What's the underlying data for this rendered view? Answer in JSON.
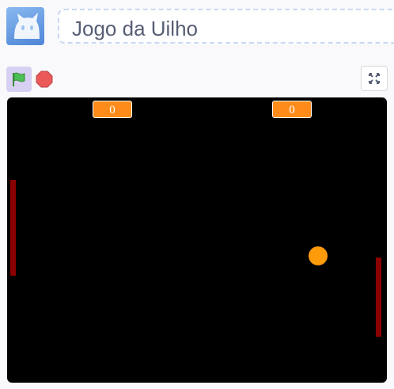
{
  "project": {
    "title": "Jogo da Uilho"
  },
  "controls": {
    "green_flag_icon": "green-flag-icon",
    "stop_icon": "stop-sign-icon",
    "fullscreen_icon": "fullscreen-icon"
  },
  "stage": {
    "score_left": "0",
    "score_right": "0"
  },
  "colors": {
    "stage_background": "#000000",
    "score_monitor": "#ff8c1a",
    "paddle": "#8b0000",
    "ball": "#ff9a0a",
    "flag_button_bg": "#d7d0f3",
    "title_text": "#575e75"
  }
}
